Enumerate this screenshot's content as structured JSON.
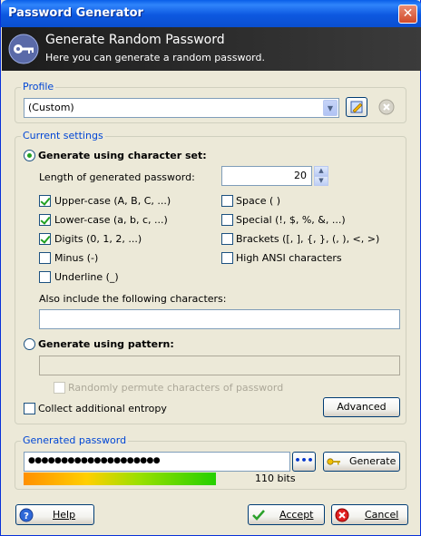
{
  "window": {
    "title": "Password Generator",
    "close": "✕"
  },
  "banner": {
    "title": "Generate Random Password",
    "subtitle": "Here you can generate a random password."
  },
  "profile": {
    "legend": "Profile",
    "selected": "(Custom)"
  },
  "settings": {
    "legend": "Current settings",
    "charset_radio": "Generate using character set:",
    "charset_selected": true,
    "length_label": "Length of generated password:",
    "length_value": "20",
    "options": [
      {
        "label": "Upper-case (A, B, C, ...)",
        "checked": true
      },
      {
        "label": "Lower-case (a, b, c, ...)",
        "checked": true
      },
      {
        "label": "Digits (0, 1, 2, ...)",
        "checked": true
      },
      {
        "label": "Minus (-)",
        "checked": false
      },
      {
        "label": "Underline (_)",
        "checked": false
      },
      {
        "label": "Space ( )",
        "checked": false
      },
      {
        "label": "Special (!, $, %, &, ...)",
        "checked": false
      },
      {
        "label": "Brackets ([, ], {, }, (, ), <, >)",
        "checked": false
      },
      {
        "label": "High ANSI characters",
        "checked": false
      }
    ],
    "also_include_label": "Also include the following characters:",
    "also_include_value": "",
    "pattern_radio": "Generate using pattern:",
    "pattern_value": "",
    "permute_label": "Randomly permute characters of password",
    "entropy_label": "Collect additional entropy",
    "advanced_label": "Advanced"
  },
  "generated": {
    "legend": "Generated password",
    "password_mask": "●●●●●●●●●●●●●●●●●●●●",
    "dots_button": "•••",
    "generate_label": "Generate",
    "quality_fraction": 0.56,
    "bits_label": "110 bits"
  },
  "footer": {
    "help": "Help",
    "accept": "Accept",
    "cancel": "Cancel"
  },
  "colors": {
    "accent": "#0046d5",
    "title_bar": "#0a5fe8",
    "banner": "#1c1c1c"
  }
}
